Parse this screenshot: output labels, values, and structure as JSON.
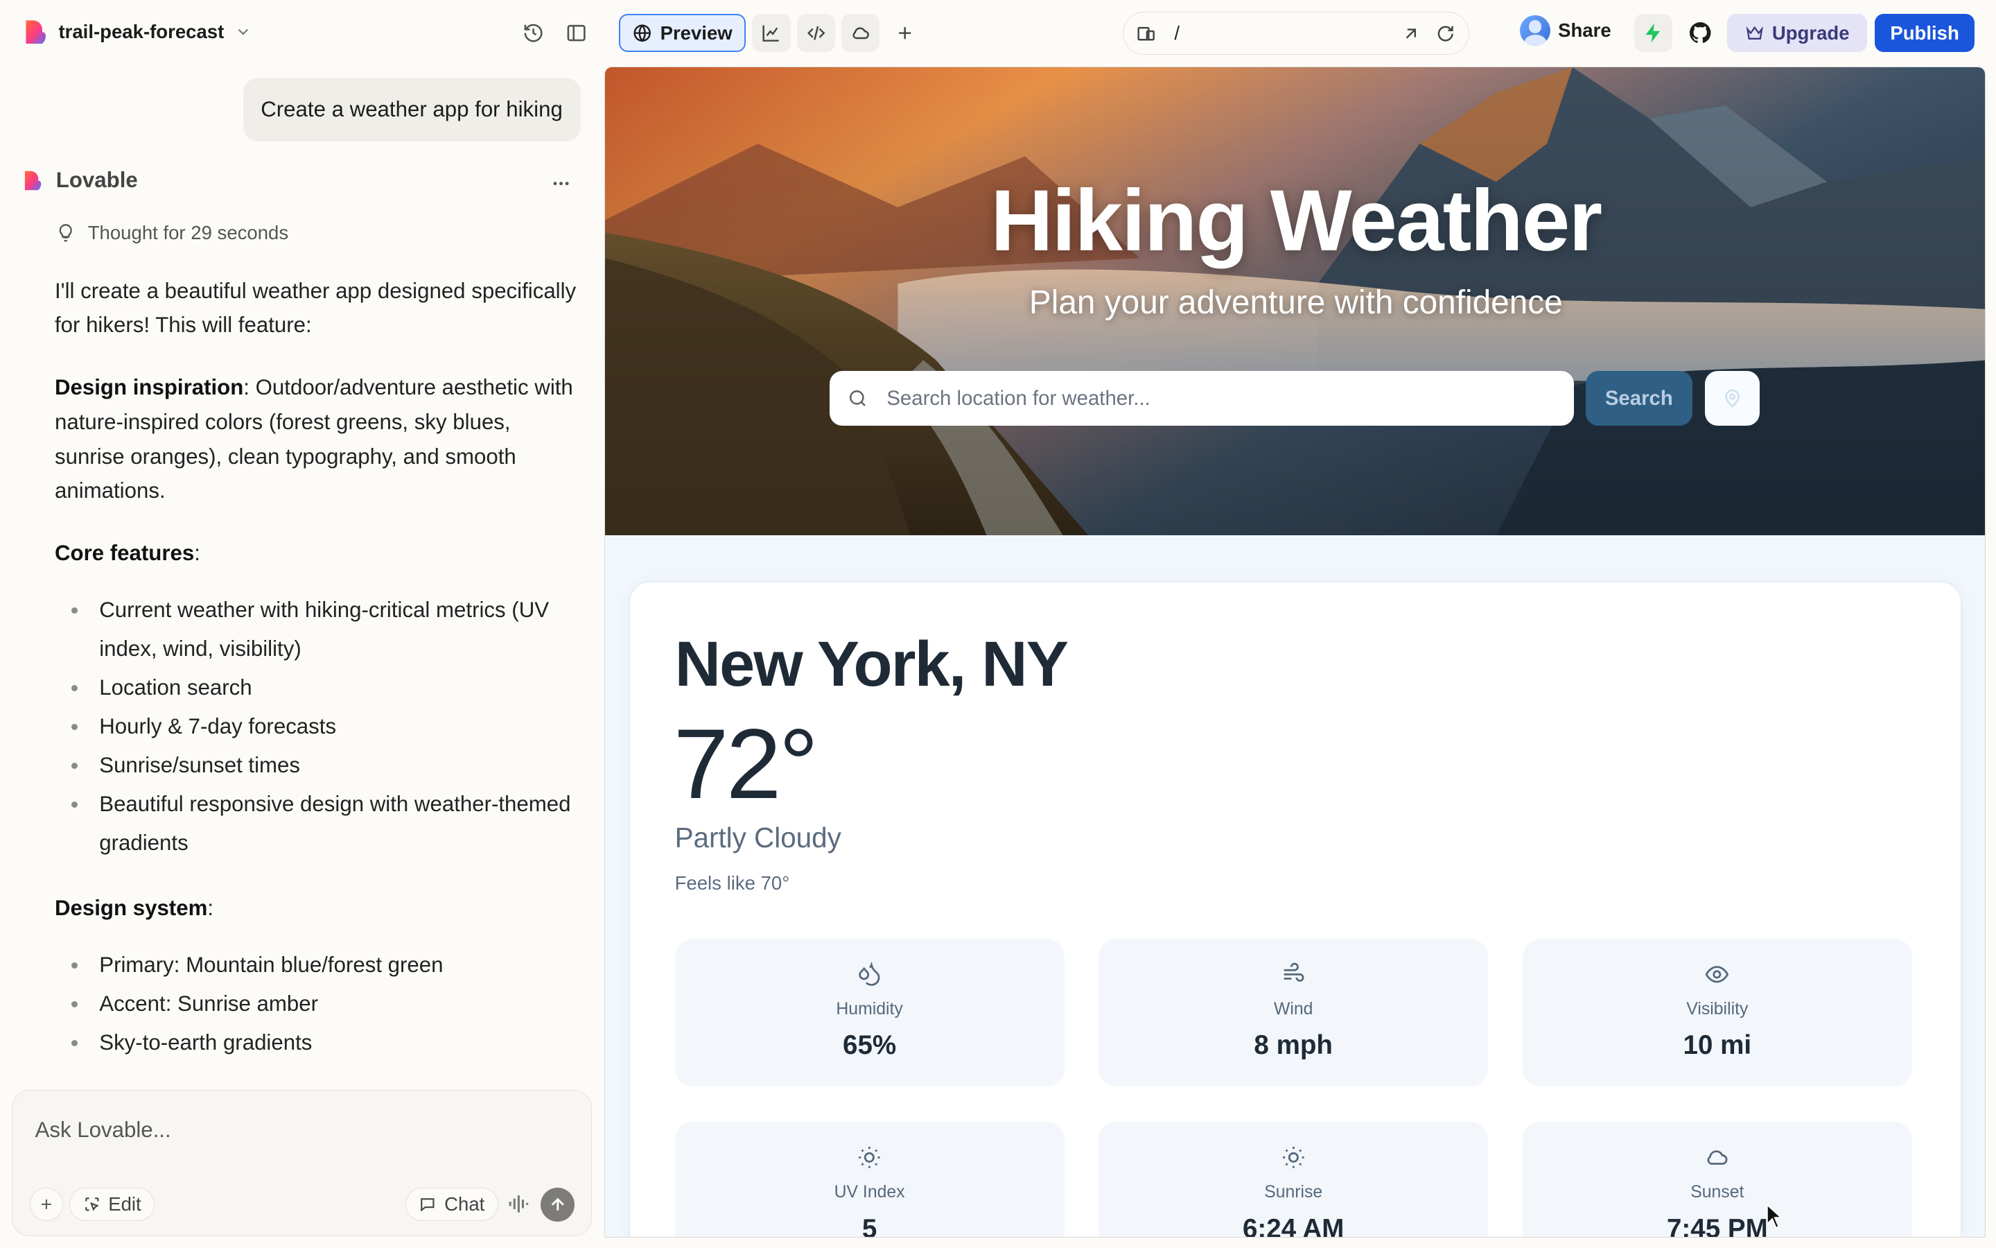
{
  "topbar": {
    "project_name": "trail-peak-forecast",
    "preview_label": "Preview",
    "url_path": "/",
    "share_label": "Share",
    "upgrade_label": "Upgrade",
    "publish_label": "Publish",
    "publish_color": "#1a56db",
    "preview_accent": "#3b82f6"
  },
  "chat": {
    "user_message": "Create a weather app for hiking",
    "assistant_name": "Lovable",
    "thought_label": "Thought for 29 seconds",
    "intro": "I'll create a beautiful weather app designed specifically for hikers! This will feature:",
    "design_inspiration_title": "Design inspiration",
    "design_inspiration_text": ": Outdoor/adventure aesthetic with nature-inspired colors (forest greens, sky blues, sunrise oranges), clean typography, and smooth animations.",
    "core_features_title": "Core features",
    "core_features_suffix": ":",
    "core_features": [
      "Current weather with hiking-critical metrics (UV index, wind, visibility)",
      "Location search",
      "Hourly & 7-day forecasts",
      "Sunrise/sunset times",
      "Beautiful responsive design with weather-themed gradients"
    ],
    "design_system_title": "Design system",
    "design_system_suffix": ":",
    "design_system": [
      "Primary: Mountain blue/forest green",
      "Accent: Sunrise amber",
      "Sky-to-earth gradients"
    ],
    "composer_placeholder": "Ask Lovable...",
    "edit_label": "Edit",
    "chat_label": "Chat"
  },
  "app": {
    "hero_title": "Hiking Weather",
    "hero_subtitle": "Plan your adventure with confidence",
    "search_placeholder": "Search location for weather...",
    "search_button": "Search",
    "city": "New York, NY",
    "temperature": "72°",
    "condition": "Partly Cloudy",
    "feels_like": "Feels like 70°",
    "metrics": [
      {
        "label": "Humidity",
        "value": "65%",
        "icon": "droplets-icon"
      },
      {
        "label": "Wind",
        "value": "8 mph",
        "icon": "wind-icon"
      },
      {
        "label": "Visibility",
        "value": "10 mi",
        "icon": "eye-icon"
      },
      {
        "label": "UV Index",
        "value": "5",
        "icon": "sun-icon"
      },
      {
        "label": "Sunrise",
        "value": "6:24 AM",
        "icon": "sun-icon"
      },
      {
        "label": "Sunset",
        "value": "7:45 PM",
        "icon": "cloud-icon"
      }
    ]
  }
}
